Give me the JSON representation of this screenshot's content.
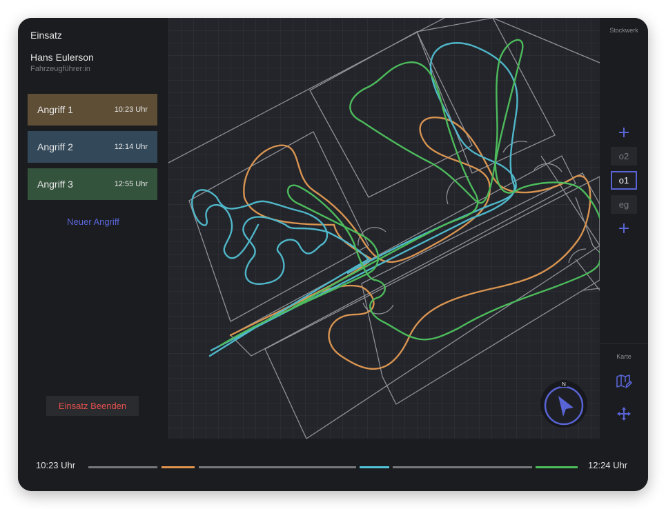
{
  "sidebar": {
    "title": "Einsatz",
    "user_name": "Hans Eulerson",
    "user_role": "Fahrzeugführer:in",
    "attacks": [
      {
        "name": "Angriff 1",
        "time": "10:23 Uhr",
        "color": "#5e4e35"
      },
      {
        "name": "Angriff 2",
        "time": "12:14 Uhr",
        "color": "#33495a"
      },
      {
        "name": "Angriff 3",
        "time": "12:55 Uhr",
        "color": "#34533d"
      }
    ],
    "new_attack_label": "Neuer Angriff",
    "end_button_label": "Einsatz Beenden"
  },
  "rightbar": {
    "floors_label": "Stockwerk",
    "add_floor_top_icon": "plus-icon",
    "floors": [
      "o2",
      "o1",
      "eg"
    ],
    "active_floor": "o1",
    "add_floor_bottom_icon": "plus-icon",
    "map_label": "Karte",
    "map_icon": "map-edit-icon",
    "move_icon": "move-arrows-icon"
  },
  "compass": {
    "north_label": "N",
    "icon": "navigation-arrow-icon"
  },
  "timeline": {
    "start_label": "10:23 Uhr",
    "end_label": "12:24 Uhr",
    "track_colors": {
      "neutral": "#77787c",
      "orange": "#e0964f",
      "blue": "#52c3d9",
      "green": "#4bbf5c"
    }
  },
  "colors": {
    "accent": "#5965d6",
    "danger": "#e2504d",
    "path_orange": "#d99450",
    "path_blue": "#4fb7c9",
    "path_green": "#4dbb5b"
  }
}
